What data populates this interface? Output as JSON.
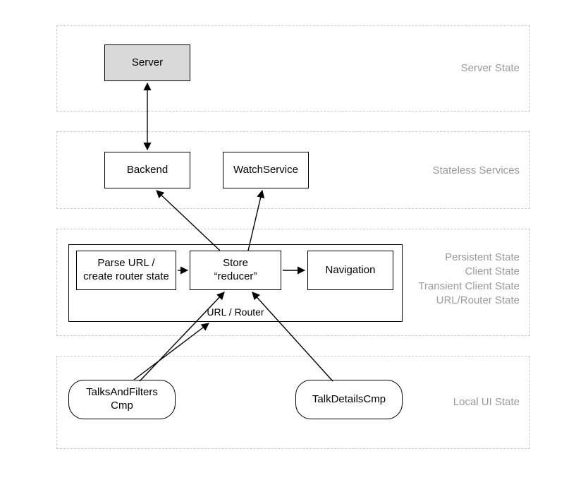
{
  "panels": {
    "server": {
      "label": "Server State"
    },
    "services": {
      "label": "Stateless Services"
    },
    "persist": {
      "label": "Persistent State\nClient State\nTransient Client State\nURL/Router State"
    },
    "local": {
      "label": "Local UI State"
    }
  },
  "nodes": {
    "server": "Server",
    "backend": "Backend",
    "watch": "WatchService",
    "parse": "Parse URL /\ncreate router state",
    "store": "Store\n“reducer”",
    "nav": "Navigation",
    "router": "URL / Router",
    "talks": "TalksAndFilters\nCmp",
    "details": "TalkDetailsCmp"
  }
}
